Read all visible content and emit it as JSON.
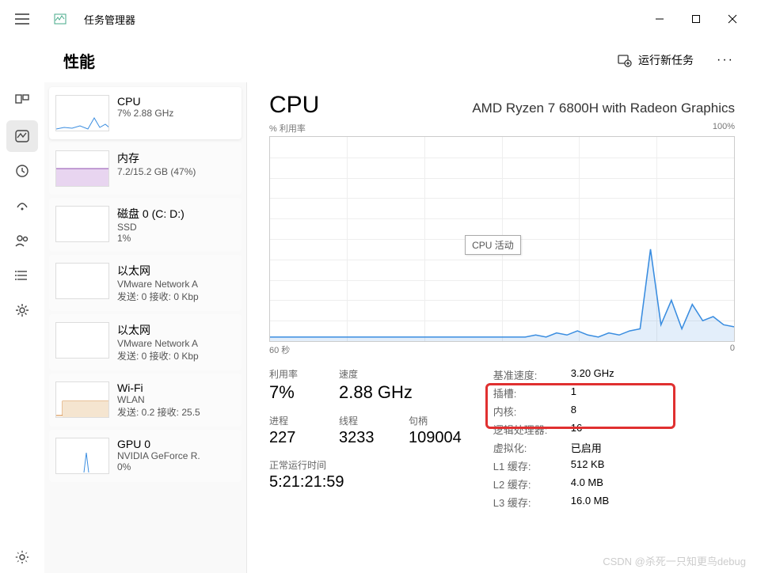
{
  "app": {
    "title": "任务管理器"
  },
  "window_controls": {
    "min": "−",
    "max": "☐",
    "close": "✕"
  },
  "header": {
    "title": "性能",
    "run_task_label": "运行新任务",
    "more_label": "···"
  },
  "sidebar": {
    "items": [
      {
        "title": "CPU",
        "sub1": "7% 2.88 GHz",
        "sub2": ""
      },
      {
        "title": "内存",
        "sub1": "7.2/15.2 GB (47%)",
        "sub2": ""
      },
      {
        "title": "磁盘 0 (C: D:)",
        "sub1": "SSD",
        "sub2": "1%"
      },
      {
        "title": "以太网",
        "sub1": "VMware Network A",
        "sub2": "发送: 0 接收: 0 Kbp"
      },
      {
        "title": "以太网",
        "sub1": "VMware Network A",
        "sub2": "发送: 0 接收: 0 Kbp"
      },
      {
        "title": "Wi-Fi",
        "sub1": "WLAN",
        "sub2": "发送: 0.2 接收: 25.5"
      },
      {
        "title": "GPU 0",
        "sub1": "NVIDIA GeForce R.",
        "sub2": "0%"
      }
    ]
  },
  "content": {
    "title": "CPU",
    "cpu_name": "AMD Ryzen 7 6800H with Radeon Graphics",
    "chart_top_left": "% 利用率",
    "chart_top_right": "100%",
    "chart_bottom_left": "60 秒",
    "chart_bottom_right": "0",
    "tooltip": "CPU 活动",
    "stats_left": [
      {
        "label": "利用率",
        "value": "7%"
      },
      {
        "label": "速度",
        "value": "2.88 GHz"
      }
    ],
    "stats_mid": [
      {
        "label": "进程",
        "value": "227"
      },
      {
        "label": "线程",
        "value": "3233"
      },
      {
        "label": "句柄",
        "value": "109004"
      }
    ],
    "uptime_label": "正常运行时间",
    "uptime_value": "5:21:21:59",
    "stats_right": [
      {
        "key": "基准速度:",
        "val": "3.20 GHz"
      },
      {
        "key": "插槽:",
        "val": "1"
      },
      {
        "key": "内核:",
        "val": "8"
      },
      {
        "key": "逻辑处理器:",
        "val": "16"
      },
      {
        "key": "虚拟化:",
        "val": "已启用"
      },
      {
        "key": "L1 缓存:",
        "val": "512 KB"
      },
      {
        "key": "L2 缓存:",
        "val": "4.0 MB"
      },
      {
        "key": "L3 缓存:",
        "val": "16.0 MB"
      }
    ]
  },
  "watermark": "CSDN @杀死一只知更鸟debug",
  "chart_data": {
    "type": "line",
    "title": "% 利用率",
    "xlabel": "60 秒",
    "ylabel": "",
    "ylim": [
      0,
      100
    ],
    "x": [
      0,
      1,
      2,
      3,
      4,
      5,
      6,
      7,
      8,
      9,
      10,
      11,
      12,
      13,
      14,
      15,
      16,
      17,
      18,
      19,
      20
    ],
    "values": [
      2,
      3,
      2,
      4,
      3,
      5,
      3,
      2,
      4,
      3,
      5,
      6,
      45,
      8,
      20,
      6,
      18,
      10,
      12,
      8,
      7
    ]
  }
}
